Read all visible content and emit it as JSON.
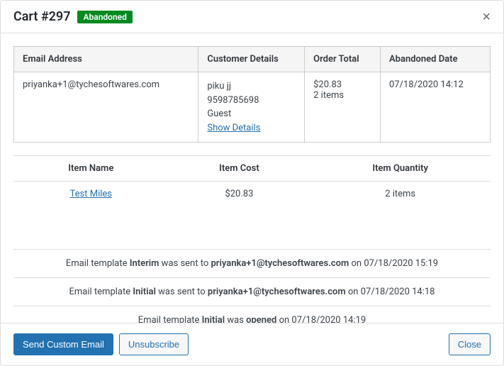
{
  "header": {
    "title": "Cart #297",
    "badge": "Abandoned"
  },
  "details": {
    "headers": {
      "email": "Email Address",
      "customer": "Customer Details",
      "total": "Order Total",
      "date": "Abandoned Date"
    },
    "email": "priyanka+1@tychesoftwares.com",
    "customer_name": "piku jj",
    "customer_phone": "9598785698",
    "customer_type": "Guest",
    "show_details": "Show Details",
    "total_amount": "$20.83",
    "total_items": "2 items",
    "date": "07/18/2020 14:12"
  },
  "items": {
    "headers": {
      "name": "Item Name",
      "cost": "Item Cost",
      "qty": "Item Quantity"
    },
    "rows": [
      {
        "name": "Test Miles",
        "cost": "$20.83",
        "qty": "2 items"
      }
    ]
  },
  "activity": {
    "rows": [
      {
        "prefix": "Email template ",
        "tpl": "Interim",
        "mid": " was sent to ",
        "target": "priyanka+1@tychesoftwares.com",
        "suffix": " on 07/18/2020 15:19"
      },
      {
        "prefix": "Email template ",
        "tpl": "Initial",
        "mid": " was sent to ",
        "target": "priyanka+1@tychesoftwares.com",
        "suffix": " on 07/18/2020 14:18"
      },
      {
        "prefix": "Email template ",
        "tpl": "Initial",
        "mid": " was ",
        "target": "opened",
        "suffix": " on 07/18/2020 14:19"
      }
    ]
  },
  "footer": {
    "send": "Send Custom Email",
    "unsubscribe": "Unsubscribe",
    "close": "Close"
  }
}
